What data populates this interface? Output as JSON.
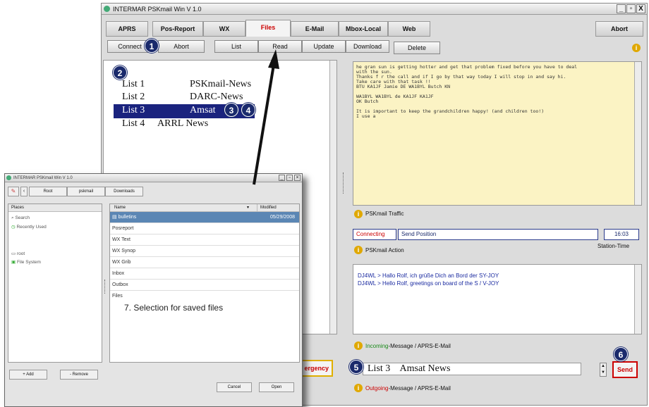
{
  "window": {
    "title": "INTERMAR PSKmail Win V 1.0",
    "min": "_",
    "max": "&#9633;",
    "close": "X"
  },
  "tabs": [
    "APRS",
    "Pos-Report",
    "WX",
    "Files",
    "E-Mail",
    "Mbox-Local",
    "Web",
    "Abort"
  ],
  "files_toolbar": {
    "connect": "Connect",
    "abort": "Abort",
    "list": "List",
    "read": "Read",
    "update": "Update",
    "download": "Download",
    "delete": "Delete"
  },
  "file_list": [
    {
      "num": "List 1",
      "name": "PSKmail-News"
    },
    {
      "num": "List 2",
      "name": "DARC-News"
    },
    {
      "num": "List 3",
      "name": "Amsat"
    },
    {
      "num": "List 4",
      "name": "ARRL News"
    }
  ],
  "traffic_text": "he gran sun is getting hotter and get that problem fixed before you have to deal\nwith the sun.\nThanks f r the call and if I go by that way today I will stop in and say hi.\nTake care with that task !!\nBTU KA1JF Jamie DE WA1BYL Butch KN\n\nWA1BYL WA1BYL de KA1JF KA1JF\nOK Butch\n\nIt is important to keep the grandchildren happy! (and children too!)\nI use a",
  "traffic_label": "PSKmail Traffic",
  "status": {
    "connecting": "Connecting",
    "send_position": "Send Position",
    "time": "16:03",
    "time_label": "Station-Time",
    "action_label": "PSKmail Action"
  },
  "incoming": {
    "lines": [
      "DJ4WL > Hallo Rolf, ich grüße Dich an Bord der SY-JOY",
      "DJ4WL > Hello Rolf, greetings on board of the S / V-JOY"
    ],
    "label_colored": "Incoming",
    "label_rest": "-Message / APRS-E-Mail"
  },
  "outgoing": {
    "value": "List 3    Amsat News",
    "label_colored": "Outgoing",
    "label_rest": "-Message / APRS-E-Mail",
    "send": "Send"
  },
  "emergency": "ergency",
  "badges": [
    "1",
    "2",
    "3",
    "4",
    "5",
    "6"
  ],
  "annotation": "7. Selection for saved files",
  "file_chooser": {
    "title": "INTERMAR PSKmail Win V 1.0",
    "path": [
      "Root",
      "pskmail",
      "Downloads"
    ],
    "places_header": "Places",
    "places": [
      "Search",
      "Recently Used",
      "root",
      "File System"
    ],
    "col_name": "Name",
    "col_modified": "Modified",
    "files": [
      {
        "name": "bulletins",
        "date": "05/29/2008"
      },
      {
        "name": "Posreport",
        "date": ""
      },
      {
        "name": "WX Text",
        "date": ""
      },
      {
        "name": "WX Synop",
        "date": ""
      },
      {
        "name": "WX Grib",
        "date": ""
      },
      {
        "name": "Inbox",
        "date": ""
      },
      {
        "name": "Outbox",
        "date": ""
      },
      {
        "name": "Files",
        "date": ""
      }
    ],
    "add": "+ Add",
    "remove": "- Remove",
    "cancel": "Cancel",
    "open": "Open"
  }
}
